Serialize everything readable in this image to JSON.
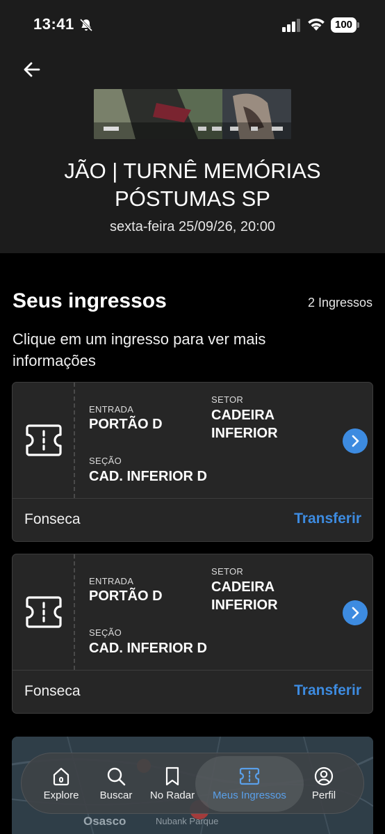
{
  "status_bar": {
    "time": "13:41",
    "battery": "100"
  },
  "header": {
    "title": "JÃO | TURNÊ MEMÓRIAS PÓSTUMAS SP",
    "date": "sexta-feira 25/09/26, 20:00"
  },
  "tickets_section": {
    "title": "Seus ingressos",
    "count": "2 Ingressos",
    "hint": "Clique em um ingresso para ver mais informações"
  },
  "tickets": [
    {
      "entrance_label": "ENTRADA",
      "entrance": "PORTÃO D",
      "sector_label": "SETOR",
      "sector": "CADEIRA INFERIOR",
      "section_label": "SEÇÃO",
      "section": "CAD. INFERIOR D",
      "holder": "Fonseca",
      "transfer_label": "Transferir"
    },
    {
      "entrance_label": "ENTRADA",
      "entrance": "PORTÃO D",
      "sector_label": "SETOR",
      "sector": "CADEIRA INFERIOR",
      "section_label": "SEÇÃO",
      "section": "CAD. INFERIOR D",
      "holder": "Fonseca",
      "transfer_label": "Transferir"
    }
  ],
  "map": {
    "labels": [
      "Osasco",
      "Nubank Parque"
    ]
  },
  "tab_bar": {
    "items": [
      {
        "label": "Explore",
        "icon": "home-icon"
      },
      {
        "label": "Buscar",
        "icon": "search-icon"
      },
      {
        "label": "No Radar",
        "icon": "bookmark-icon"
      },
      {
        "label": "Meus Ingressos",
        "icon": "ticket-icon",
        "active": true
      },
      {
        "label": "Perfil",
        "icon": "profile-icon"
      }
    ]
  },
  "colors": {
    "accent": "#3d8be0",
    "background": "#000000",
    "card": "#262626",
    "header": "#1c1c1c"
  }
}
